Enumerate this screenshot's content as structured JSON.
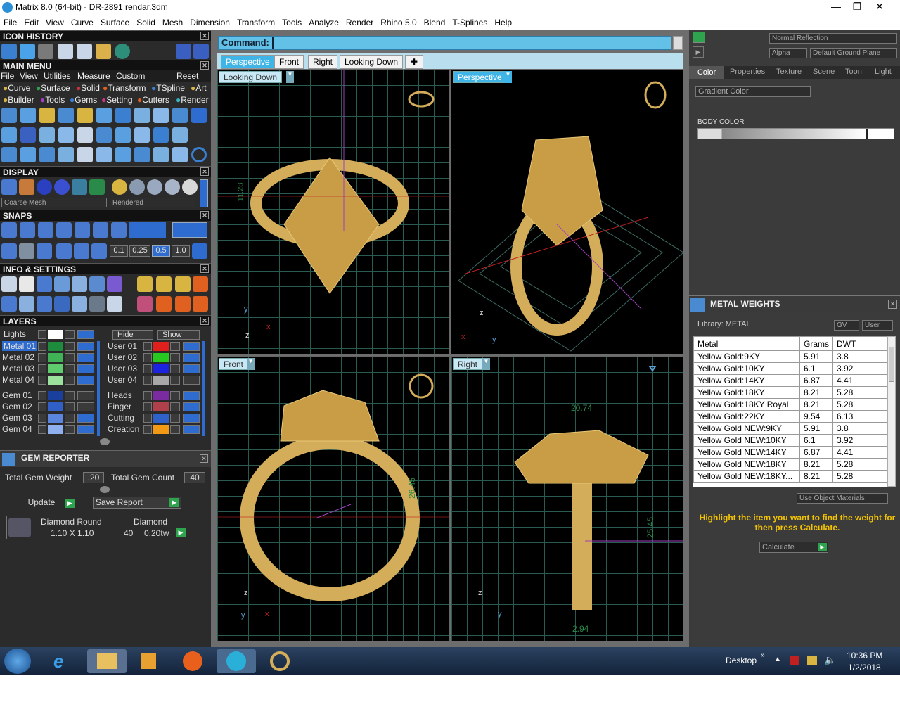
{
  "window": {
    "title": "Matrix 8.0 (64-bit) - DR-2891  rendar.3dm",
    "minimize": "—",
    "restore": "❐",
    "close": "✕"
  },
  "menubar": [
    "File",
    "Edit",
    "View",
    "Curve",
    "Surface",
    "Solid",
    "Mesh",
    "Dimension",
    "Transform",
    "Tools",
    "Analyze",
    "Render",
    "Rhino 5.0",
    "Blend",
    "T-Splines",
    "Help"
  ],
  "icon_history": {
    "title": "ICON HISTORY"
  },
  "main_menu": {
    "title": "MAIN MENU",
    "row1": [
      "File",
      "View",
      "Utilities",
      "Measure",
      "Custom"
    ],
    "reset": "Reset",
    "row2": [
      "Curve",
      "Surface",
      "Solid",
      "Transform",
      "TSpline",
      "Art"
    ],
    "row3": [
      "Builder",
      "Tools",
      "Gems",
      "Setting",
      "Cutters",
      "Render"
    ]
  },
  "display": {
    "title": "DISPLAY",
    "mesh": "Coarse Mesh",
    "mode": "Rendered"
  },
  "snaps": {
    "title": "SNAPS",
    "values": [
      "0.1",
      "0.25",
      "0.5",
      "1.0"
    ]
  },
  "info": {
    "title": "INFO & SETTINGS"
  },
  "layers": {
    "title": "LAYERS",
    "lights": "Lights",
    "hide": "Hide",
    "show": "Show",
    "left": [
      {
        "name": "Metal 01",
        "color": "#1e8c3c"
      },
      {
        "name": "Metal 02",
        "color": "#3fb356"
      },
      {
        "name": "Metal 03",
        "color": "#5fcc6e"
      },
      {
        "name": "Metal 04",
        "color": "#9be39d"
      },
      {
        "name": "Gem 01",
        "color": "#1b3f9c"
      },
      {
        "name": "Gem 02",
        "color": "#2f5fc7"
      },
      {
        "name": "Gem 03",
        "color": "#5a86dd"
      },
      {
        "name": "Gem 04",
        "color": "#8fb0ee"
      }
    ],
    "right": [
      {
        "name": "User 01",
        "color": "#e0201c"
      },
      {
        "name": "User 02",
        "color": "#27c81f"
      },
      {
        "name": "User 03",
        "color": "#1d24e0"
      },
      {
        "name": "User 04",
        "color": "#a8a8a8"
      },
      {
        "name": "Heads",
        "color": "#7a2ba0"
      },
      {
        "name": "Finger",
        "color": "#b0414a"
      },
      {
        "name": "Cutting",
        "color": "#2e62c9"
      },
      {
        "name": "Creation",
        "color": "#f29a15"
      }
    ]
  },
  "gem_reporter": {
    "title": "GEM REPORTER",
    "weight_label": "Total Gem Weight",
    "weight": ".20",
    "count_label": "Total Gem Count",
    "count": "40",
    "update": "Update",
    "save": "Save Report",
    "col1": "Diamond Round",
    "col2": "Diamond",
    "size": "1.10 X 1.10",
    "qty": "40",
    "tw": "0.20tw"
  },
  "command": {
    "label": "Command:"
  },
  "view_tabs": [
    "Perspective",
    "Front",
    "Right",
    "Looking Down"
  ],
  "viewports": {
    "tl": {
      "label": "Looking Down",
      "dim": "11.28",
      "axis1": "y",
      "axis2": "x",
      "axis3": "z"
    },
    "tr": {
      "label": "Perspective",
      "axis1": "z",
      "axis2": "x",
      "axis3": "y"
    },
    "bl": {
      "label": "Front",
      "dim": "26.45",
      "axis1": "z",
      "axis2": "x",
      "axis3": "y"
    },
    "br": {
      "label": "Right",
      "dim_top": "20.74",
      "dim": "25.45",
      "dim_bottom": "2.94",
      "axis1": "z",
      "axis2": "y"
    }
  },
  "render_panel": {
    "reflection": "Normal Reflection",
    "alpha": "Alpha",
    "ground": "Default Ground Plane",
    "tabs": [
      "Color",
      "Properties",
      "Texture",
      "Scene",
      "Toon",
      "Light"
    ],
    "gradient": "Gradient Color",
    "body_color": "BODY COLOR"
  },
  "metal_weights": {
    "title": "METAL WEIGHTS",
    "library": "Library: METAL",
    "gv": "GV",
    "user": "User",
    "headers": [
      "Metal",
      "Grams",
      "DWT"
    ],
    "rows": [
      [
        "Yellow Gold:9KY",
        "5.91",
        "3.8"
      ],
      [
        "Yellow Gold:10KY",
        "6.1",
        "3.92"
      ],
      [
        "Yellow Gold:14KY",
        "6.87",
        "4.41"
      ],
      [
        "Yellow Gold:18KY",
        "8.21",
        "5.28"
      ],
      [
        "Yellow Gold:18KY Royal",
        "8.21",
        "5.28"
      ],
      [
        "Yellow Gold:22KY",
        "9.54",
        "6.13"
      ],
      [
        "Yellow Gold NEW:9KY",
        "5.91",
        "3.8"
      ],
      [
        "Yellow Gold NEW:10KY",
        "6.1",
        "3.92"
      ],
      [
        "Yellow Gold NEW:14KY",
        "6.87",
        "4.41"
      ],
      [
        "Yellow Gold NEW:18KY",
        "8.21",
        "5.28"
      ],
      [
        "Yellow Gold NEW:18KY...",
        "8.21",
        "5.28"
      ]
    ],
    "use_object": "Use Object Materials",
    "hint": "Highlight the item you want to find the weight for then press Calculate.",
    "calculate": "Calculate"
  },
  "taskbar": {
    "desktop": "Desktop",
    "time": "10:36 PM",
    "date": "1/2/2018"
  },
  "colors": {
    "accent_blue": "#3fb4e6",
    "gold": "#d4ad5a",
    "hint_yellow": "#f5c400"
  }
}
